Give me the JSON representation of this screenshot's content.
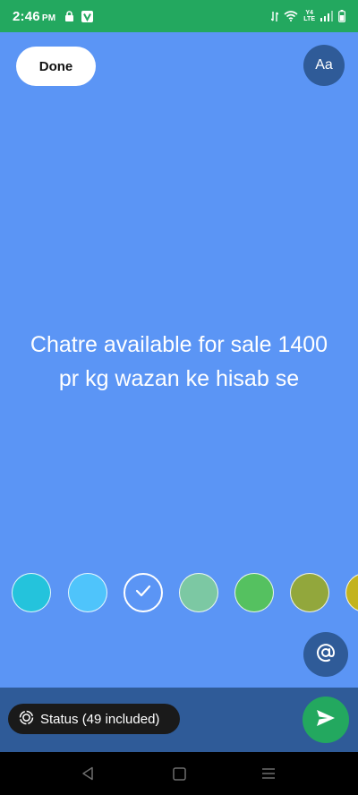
{
  "status_bar": {
    "time": "2:46",
    "ampm": "PM",
    "network_label_1": "Y4",
    "network_label_2": "LTE",
    "colors": {
      "background": "#23a85f"
    }
  },
  "editor": {
    "done_label": "Done",
    "font_button_label": "Aa",
    "text": "Chatre available for sale 1400 pr kg wazan ke hisab se",
    "background_color": "#5b95f5",
    "mention_label": "@"
  },
  "palette": {
    "swatches": [
      {
        "color": "#24c3dc",
        "selected": false
      },
      {
        "color": "#4fc4fb",
        "selected": false
      },
      {
        "color": "#5b95f5",
        "selected": true
      },
      {
        "color": "#7cc8a3",
        "selected": false
      },
      {
        "color": "#55c160",
        "selected": false
      },
      {
        "color": "#92a73c",
        "selected": false
      },
      {
        "color": "#c3b31e",
        "selected": false
      }
    ]
  },
  "bottom": {
    "audience_label": "Status (49 included)",
    "send_icon": "send-icon",
    "colors": {
      "bar": "#2f5b98",
      "send": "#23a85f"
    }
  },
  "nav": {
    "back_icon": "back-icon",
    "home_icon": "home-icon",
    "menu_icon": "menu-icon"
  }
}
